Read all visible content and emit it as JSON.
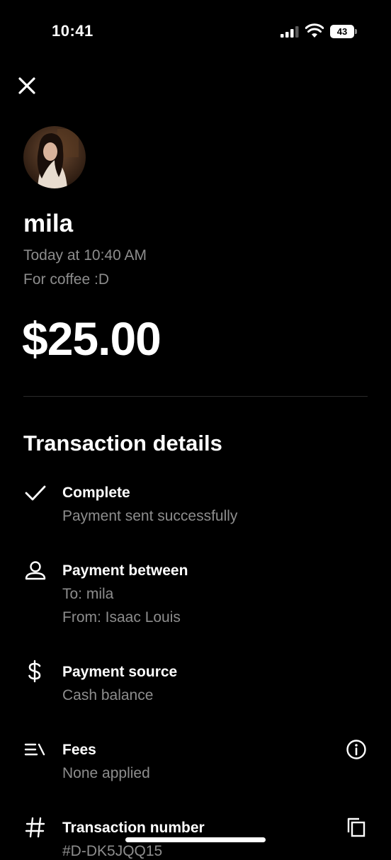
{
  "status_bar": {
    "time": "10:41",
    "battery": "43",
    "icons": [
      "signal-icon",
      "wifi-icon",
      "battery-icon"
    ]
  },
  "header": {
    "close_icon": "close-icon"
  },
  "recipient": {
    "name": "mila",
    "timestamp": "Today at 10:40 AM",
    "note": "For coffee :D"
  },
  "amount": "$25.00",
  "details": {
    "title": "Transaction details",
    "status": {
      "icon": "checkmark-icon",
      "title": "Complete",
      "subtitle": "Payment sent successfully"
    },
    "parties": {
      "icon": "person-icon",
      "title": "Payment between",
      "to": "To: mila",
      "from": "From: Isaac Louis"
    },
    "source": {
      "icon": "dollar-icon",
      "title": "Payment source",
      "subtitle": "Cash balance"
    },
    "fees": {
      "icon": "fees-icon",
      "title": "Fees",
      "subtitle": "None applied",
      "action_icon": "info-icon"
    },
    "number": {
      "icon": "hash-icon",
      "title": "Transaction number",
      "subtitle": "#D-DK5JQQ15",
      "action_icon": "copy-icon"
    }
  }
}
